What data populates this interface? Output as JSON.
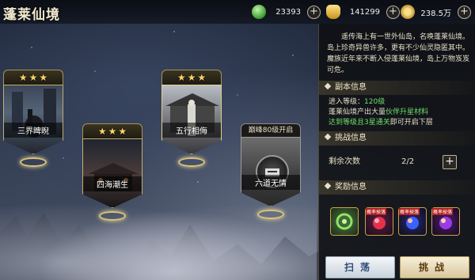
{
  "header": {
    "title": "蓬莱仙境",
    "currencies": [
      {
        "icon": "jade-icon",
        "value": "23393"
      },
      {
        "icon": "gold-ingot-icon",
        "value": "141299"
      },
      {
        "icon": "coin-icon",
        "value": "238.5万"
      }
    ]
  },
  "stages": [
    {
      "name": "三界睥睨",
      "stars": 3,
      "locked": false
    },
    {
      "name": "四海潮生",
      "stars": 3,
      "locked": false
    },
    {
      "name": "五行相侮",
      "stars": 3,
      "locked": false
    },
    {
      "name": "六道无情",
      "stars": 0,
      "locked": true,
      "unlock_text": "巅峰80级开启"
    }
  ],
  "panel": {
    "description": "遥传海上有一世外仙岛，名唤蓬莱仙境。岛上珍奇异兽许多，更有不少仙灵隐匿其中。魔族近年来不断入侵蓬莱仙境，岛上万物岌岌可危。",
    "sections": {
      "dungeon_info": "副本信息",
      "challenge_info": "挑战信息",
      "reward_info": "奖励信息"
    },
    "entry_level_label": "进入等级：",
    "entry_level_value": "120级",
    "drop_text_prefix": "蓬莱仙境产出大量",
    "drop_text_highlight": "伙伴升星材料",
    "unlock_condition_highlight": "达到等级且3星通关",
    "unlock_condition_suffix": "即可开启下层",
    "remaining_label": "剩余次数",
    "remaining_value": "2/2",
    "reward_tag": "概率掉落",
    "rewards": [
      {
        "icon": "companion-item-icon",
        "tag": false
      },
      {
        "icon": "red-orb-icon",
        "tag": true
      },
      {
        "icon": "blue-orb-icon",
        "tag": true
      },
      {
        "icon": "purple-orb-icon",
        "tag": true
      }
    ],
    "sweep_button": "扫荡",
    "fight_button": "挑战"
  }
}
